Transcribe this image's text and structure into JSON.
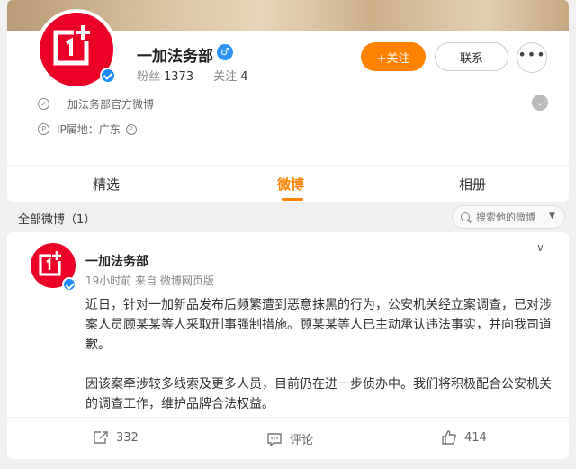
{
  "profile": {
    "name": "一加法务部",
    "gender_symbol": "♂",
    "stats": {
      "fans_label": "粉丝",
      "fans": "1373",
      "follow_label": "关注",
      "follow": "4"
    },
    "follow_button": "+关注",
    "contact_button": "联系",
    "more_button": "•••",
    "official_desc": "一加法务部官方微博",
    "ip_location": "IP属地：广东"
  },
  "tabs": [
    {
      "label": "精选"
    },
    {
      "label": "微博"
    },
    {
      "label": "相册"
    }
  ],
  "filter": {
    "label": "全部微博（1）",
    "search_placeholder": "搜索他的微博"
  },
  "post": {
    "author": "一加法务部",
    "meta": "19小时前 来自 微博网页版",
    "paragraphs": [
      "近日，针对一加新品发布后频繁遭到恶意抹黑的行为，公安机关经立案调查，已对涉案人员顾某某等人采取刑事强制措施。顾某某等人已主动承认违法事实，并向我司道歉。",
      "因该案牵涉较多线索及更多人员，目前仍在进一步侦办中。我们将积极配合公安机关的调查工作，维护品牌合法权益。"
    ],
    "reposts": "332",
    "comments_label": "评论",
    "likes": "414"
  },
  "colors": {
    "accent": "#ff8200",
    "brand_red": "#eb0028",
    "verify_blue": "#1a8cff"
  }
}
